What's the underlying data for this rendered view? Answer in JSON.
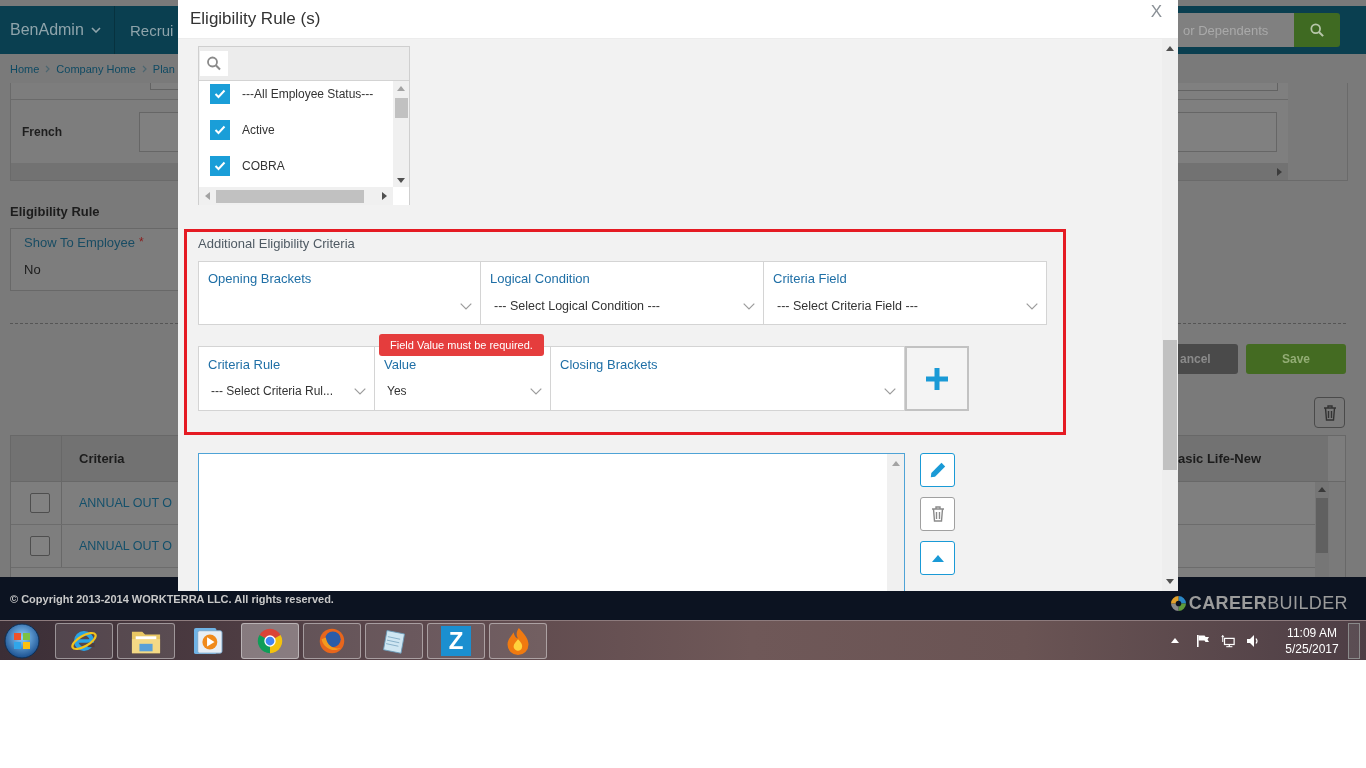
{
  "browser_page": {
    "nav": [
      {
        "label": "BenAdmin",
        "dropdown": true
      },
      {
        "label": "Recrui",
        "dropdown": false
      }
    ],
    "search": {
      "placeholder": "or Dependents"
    },
    "breadcrumbs": [
      "Home",
      "Company Home",
      "Plan"
    ],
    "language_row": {
      "label": "French"
    },
    "eligibility": {
      "title": "Eligibility Rule",
      "field_label": "Show To Employee",
      "required_mark": "*",
      "value": "No"
    },
    "buttons": [
      {
        "label": "ancel",
        "kind": "secondary"
      },
      {
        "label": "Save",
        "kind": "primary"
      }
    ],
    "table": {
      "columns": [
        "Criteria",
        "asic Life-New"
      ],
      "rows": [
        {
          "checked": false,
          "criteria": "ANNUAL OUT O"
        },
        {
          "checked": false,
          "criteria": "ANNUAL OUT O"
        }
      ]
    }
  },
  "modal": {
    "title": "Eligibility Rule (s)",
    "close": "X",
    "status_list": {
      "items": [
        {
          "label": "---All Employee Status---",
          "checked": true
        },
        {
          "label": "Active",
          "checked": true
        },
        {
          "label": "COBRA",
          "checked": true
        }
      ]
    },
    "criteria_panel": {
      "title": "Additional Eligibility Criteria",
      "highlighted": true,
      "field_rows": [
        {
          "fields": [
            {
              "label": "Opening Brackets"
            },
            {
              "label": "Logical Condition",
              "value": "--- Select Logical Condition ---"
            },
            {
              "label": "Criteria Field",
              "value": "--- Select Criteria Field ---"
            }
          ]
        },
        {
          "add_button": true,
          "fields": [
            {
              "label": "Criteria Rule",
              "value": "--- Select Criteria Rul..."
            },
            {
              "label": "Value",
              "value": "Yes",
              "error": "Field Value must be required."
            },
            {
              "label": "Closing Brackets"
            }
          ]
        }
      ]
    },
    "rule_actions": [
      {
        "kind": "edit"
      },
      {
        "kind": "delete"
      },
      {
        "kind": "move-up"
      }
    ]
  },
  "footer": {
    "copyright": "© Copyright 2013-2014 WORKTERRA LLC. All rights reserved.",
    "logo_text": "**CAREER**BUILDER"
  },
  "taskbar": {
    "apps": [
      {
        "kind": "ie",
        "running": true,
        "selected": false
      },
      {
        "kind": "folder",
        "running": true,
        "selected": false
      },
      {
        "kind": "media",
        "running": false,
        "selected": false
      },
      {
        "kind": "chrome",
        "running": true,
        "selected": true
      },
      {
        "kind": "firefox",
        "running": true,
        "selected": false
      },
      {
        "kind": "notepad",
        "running": true,
        "selected": false
      },
      {
        "kind": "z",
        "label": "Z",
        "running": true,
        "selected": false
      },
      {
        "kind": "flame",
        "running": true,
        "selected": false
      }
    ],
    "clock": {
      "time": "11:09 AM",
      "date": "5/25/2017"
    }
  }
}
